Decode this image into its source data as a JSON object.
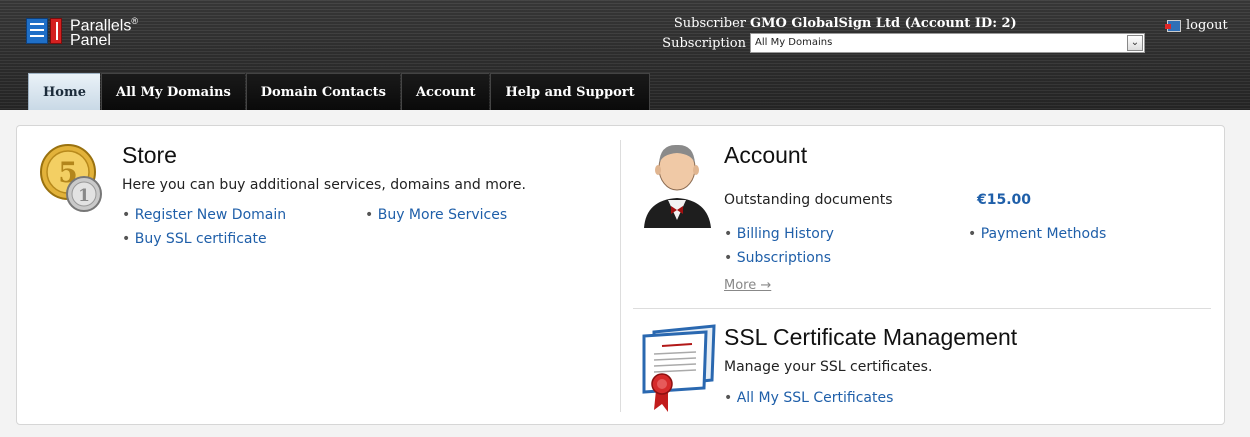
{
  "header": {
    "logo_line1": "Parallels",
    "logo_reg": "®",
    "logo_line2": "Panel",
    "subscriber_label": "Subscriber",
    "subscriber_value": "GMO GlobalSign Ltd (Account ID: 2)",
    "subscription_label": "Subscription",
    "subscription_selected": "All My Domains",
    "logout_label": "logout"
  },
  "tabs": [
    {
      "label": "Home",
      "active": true
    },
    {
      "label": "All My Domains"
    },
    {
      "label": "Domain Contacts"
    },
    {
      "label": "Account"
    },
    {
      "label": "Help and Support"
    }
  ],
  "store": {
    "title": "Store",
    "description": "Here you can buy additional services, domains and more.",
    "links": [
      "Register New Domain",
      "Buy More Services",
      "Buy SSL certificate"
    ]
  },
  "account": {
    "title": "Account",
    "outstanding_label": "Outstanding documents",
    "outstanding_value": "€15.00",
    "links": [
      "Billing History",
      "Payment Methods",
      "Subscriptions"
    ],
    "more": "More →"
  },
  "ssl": {
    "title": "SSL Certificate Management",
    "description": "Manage your SSL certificates.",
    "links": [
      "All My SSL Certificates"
    ]
  },
  "colors": {
    "link": "#1f5fa9",
    "header_bg": "#2f2f2f",
    "active_tab": "#c9d9e6"
  }
}
